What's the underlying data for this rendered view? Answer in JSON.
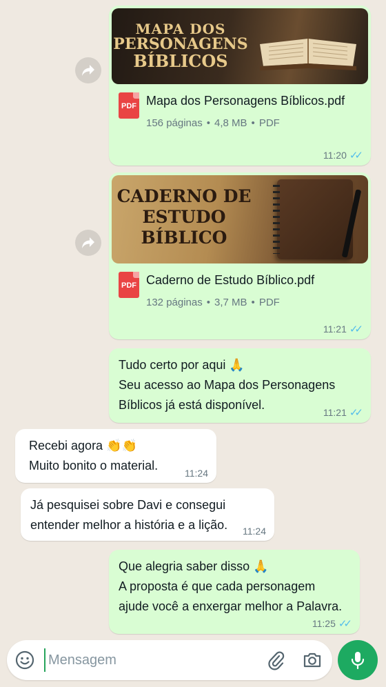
{
  "messages": [
    {
      "type": "document",
      "thumb_lines": [
        "MAPA DOS",
        "PERSONAGENS",
        "BÍBLICOS"
      ],
      "file_name": "Mapa dos Personagens Bíblicos.pdf",
      "pages": "156 páginas",
      "size": "4,8 MB",
      "format": "PDF",
      "icon_label": "PDF",
      "time": "11:20",
      "status": "read"
    },
    {
      "type": "document",
      "thumb_lines": [
        "CADERNO DE",
        "ESTUDO",
        "BÍBLICO"
      ],
      "file_name": "Caderno de Estudo Bíblico.pdf",
      "pages": "132 páginas",
      "size": "3,7 MB",
      "format": "PDF",
      "icon_label": "PDF",
      "time": "11:21",
      "status": "read"
    },
    {
      "type": "text_out",
      "lines": [
        "Tudo certo por aqui 🙏",
        "Seu acesso ao Mapa dos Personagens",
        "Bíblicos já está disponível."
      ],
      "time": "11:21",
      "status": "read"
    },
    {
      "type": "text_in",
      "lines": [
        "Recebi agora 👏👏",
        "Muito bonito o material."
      ],
      "time": "11:24"
    },
    {
      "type": "text_in",
      "lines": [
        "Já pesquisei sobre Davi e consegui",
        "entender melhor a história e a lição."
      ],
      "time": "11:24"
    },
    {
      "type": "text_out",
      "lines": [
        "Que alegria saber disso 🙏",
        "A proposta é que cada personagem",
        "ajude você a enxergar melhor a Palavra."
      ],
      "time": "11:25",
      "status": "read"
    }
  ],
  "composer": {
    "placeholder": "Mensagem",
    "icons": [
      "emoji-icon",
      "paperclip-icon",
      "camera-icon",
      "mic-icon"
    ]
  },
  "colors": {
    "outgoing_bubble": "#d9fdd3",
    "incoming_bubble": "#ffffff",
    "background": "#efe9e1",
    "read_ticks": "#53bdeb",
    "mic_button": "#1daa61",
    "pdf_icon": "#e94444"
  }
}
